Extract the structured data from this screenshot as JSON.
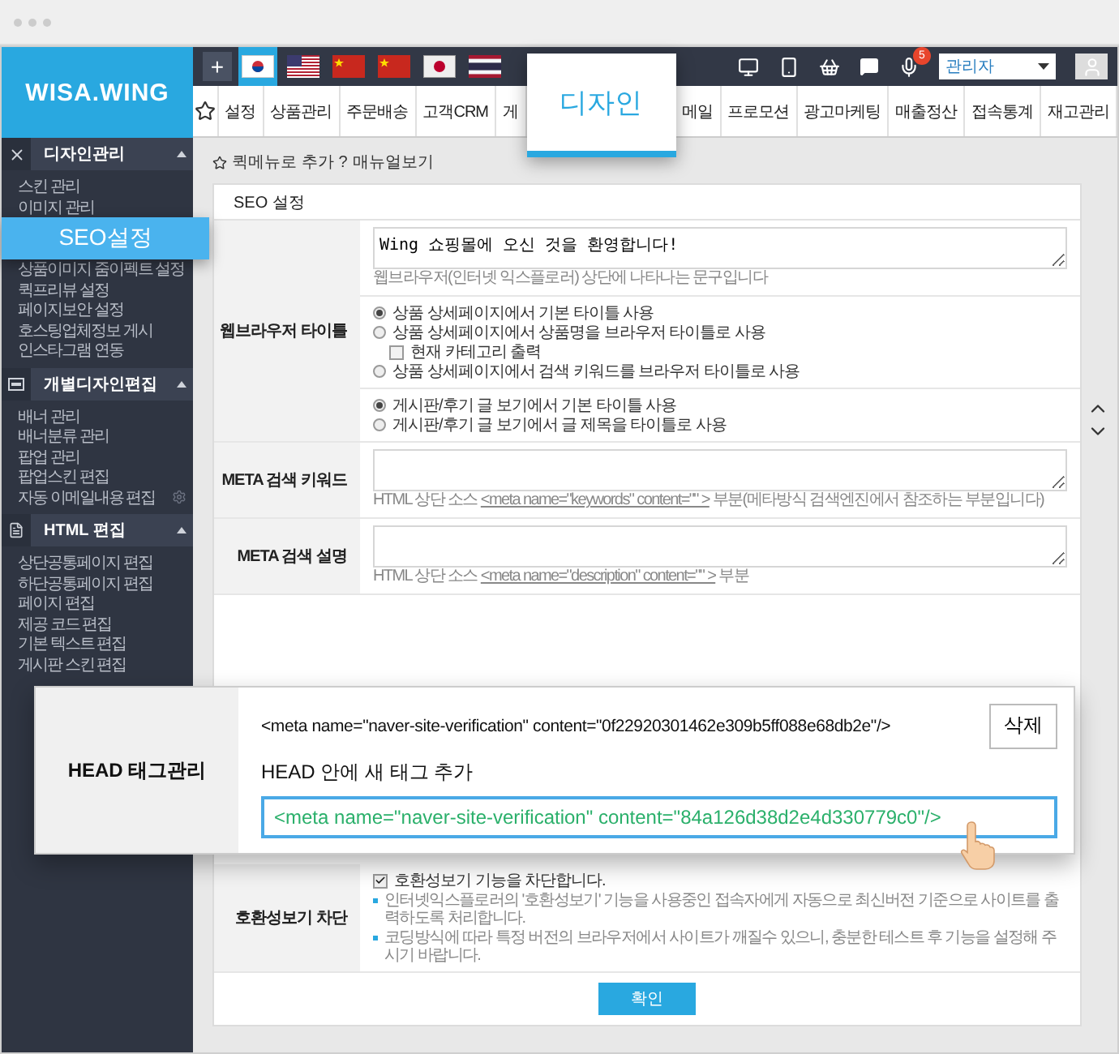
{
  "logo": "WISA.WING",
  "toolbar": {
    "add": "+",
    "languages": [
      {
        "kind": "korea",
        "selected": true
      },
      {
        "kind": "usa",
        "selected": false
      },
      {
        "kind": "china",
        "selected": false
      },
      {
        "kind": "china",
        "selected": false
      },
      {
        "kind": "japan",
        "selected": false
      },
      {
        "kind": "thailand",
        "selected": false
      }
    ],
    "notification_count": "5",
    "user_select": "관리자"
  },
  "nav": {
    "items": [
      {
        "label": "설정",
        "kind": "tab"
      },
      {
        "label": "상품관리",
        "kind": "tab"
      },
      {
        "label": "주문배송",
        "kind": "tab"
      },
      {
        "label": "고객CRM",
        "kind": "tab"
      },
      {
        "label": "게",
        "kind": "tab"
      },
      {
        "label": "디자인",
        "kind": "popout"
      },
      {
        "label": "메일",
        "kind": "tab"
      },
      {
        "label": "프로모션",
        "kind": "tab"
      },
      {
        "label": "광고마케팅",
        "kind": "tab"
      },
      {
        "label": "매출정산",
        "kind": "tab"
      },
      {
        "label": "접속통계",
        "kind": "tab"
      },
      {
        "label": "재고관리",
        "kind": "tab"
      }
    ]
  },
  "sidebar": {
    "sections": [
      {
        "title": "디자인관리",
        "kind": "close",
        "expanded": true,
        "items": [
          {
            "label": "스킨 관리",
            "settings": false
          },
          {
            "label": "이미지 관리",
            "settings": false
          },
          {
            "label": "SEO설정",
            "kind": "popout"
          },
          {
            "label": "상품이미지 줌이펙트 설정",
            "settings": false
          },
          {
            "label": "퀵프리뷰 설정",
            "settings": false
          },
          {
            "label": "페이지보안 설정",
            "settings": false
          },
          {
            "label": "호스팅업체정보 게시",
            "settings": false
          },
          {
            "label": "인스타그램 연동",
            "settings": false
          }
        ]
      },
      {
        "title": "개별디자인편집",
        "kind": "panel",
        "expanded": true,
        "items": [
          {
            "label": "배너 관리",
            "settings": false
          },
          {
            "label": "배너분류 관리",
            "settings": false
          },
          {
            "label": "팝업 관리",
            "settings": false
          },
          {
            "label": "팝업스킨 편집",
            "settings": false
          },
          {
            "label": "자동 이메일내용 편집",
            "settings": true
          }
        ]
      },
      {
        "title": "HTML 편집",
        "kind": "document",
        "expanded": true,
        "items": [
          {
            "label": "상단공통페이지 편집",
            "settings": false
          },
          {
            "label": "하단공통페이지 편집",
            "settings": false
          },
          {
            "label": "페이지 편집",
            "settings": false
          },
          {
            "label": "제공 코드 편집",
            "settings": false
          },
          {
            "label": "기본 텍스트 편집",
            "settings": false
          },
          {
            "label": "게시판 스킨 편집",
            "settings": false
          }
        ]
      }
    ]
  },
  "breadcrumb": {
    "quick_add": "퀵메뉴로 추가",
    "help_mark": "?",
    "manual": "매뉴얼보기"
  },
  "card": {
    "title": "SEO 설정",
    "browser_title": {
      "label": "웹브라우저 타이틀",
      "value": "Wing 쇼핑몰에 오신 것을 환영합니다!",
      "hint": "웹브라우저(인터넷 익스플로러) 상단에 나타나는 문구입니다",
      "product_options": [
        {
          "label": "상품 상세페이지에서 기본 타이틀 사용",
          "selected": true
        },
        {
          "label": "상품 상세페이지에서 상품명을 브라우저 타이틀로 사용",
          "selected": false
        },
        {
          "label": "상품 상세페이지에서 검색 키워드를 브라우저 타이틀로 사용",
          "selected": false
        }
      ],
      "category_option": {
        "label": "현재 카테고리 출력",
        "checked": false
      },
      "board_options": [
        {
          "label": "게시판/후기 글 보기에서 기본 타이틀 사용",
          "selected": true
        },
        {
          "label": "게시판/후기 글 보기에서 글 제목을 타이틀로 사용",
          "selected": false
        }
      ]
    },
    "meta_fields": [
      {
        "label": "META 검색 키워드",
        "hint_before": "HTML 상단 소스",
        "hint_code": "<meta name=\"keywords\" content=\"\" >",
        "hint_after": "부분(메타방식 검색엔진에서 참조하는 부분입니다)"
      },
      {
        "label": "META 검색 설명",
        "hint_before": "HTML 상단 소스",
        "hint_code": "<meta name=\"description\" content=\"\" >",
        "hint_after": "부분"
      }
    ],
    "compat": {
      "label": "호환성보기 차단",
      "option": {
        "label": "호환성보기 기능을 차단합니다.",
        "checked": true
      },
      "notes": [
        "인터넷익스플로러의 '호환성보기' 기능을 사용중인 접속자에게 자동으로 최신버전 기준으로 사이트를 출력하도록 처리합니다.",
        "코딩방식에 따라 특정 버전의 브라우저에서 사이트가 깨질수 있으니, 충분한 테스트 후 기능을 설정해 주시기 바랍니다."
      ]
    },
    "submit": "확인"
  },
  "head_tags": {
    "label": "HEAD 태그관리",
    "existing_tag": "<meta name=\"naver-site-verification\" content=\"0f22920301462e309b5ff088e68db2e\"/>",
    "delete": "삭제",
    "new_tag_label": "HEAD 안에 새 태그 추가",
    "new_tag_value": "<meta name=\"naver-site-verification\" content=\"84a126d38d2e4d330779c0\"/>"
  }
}
